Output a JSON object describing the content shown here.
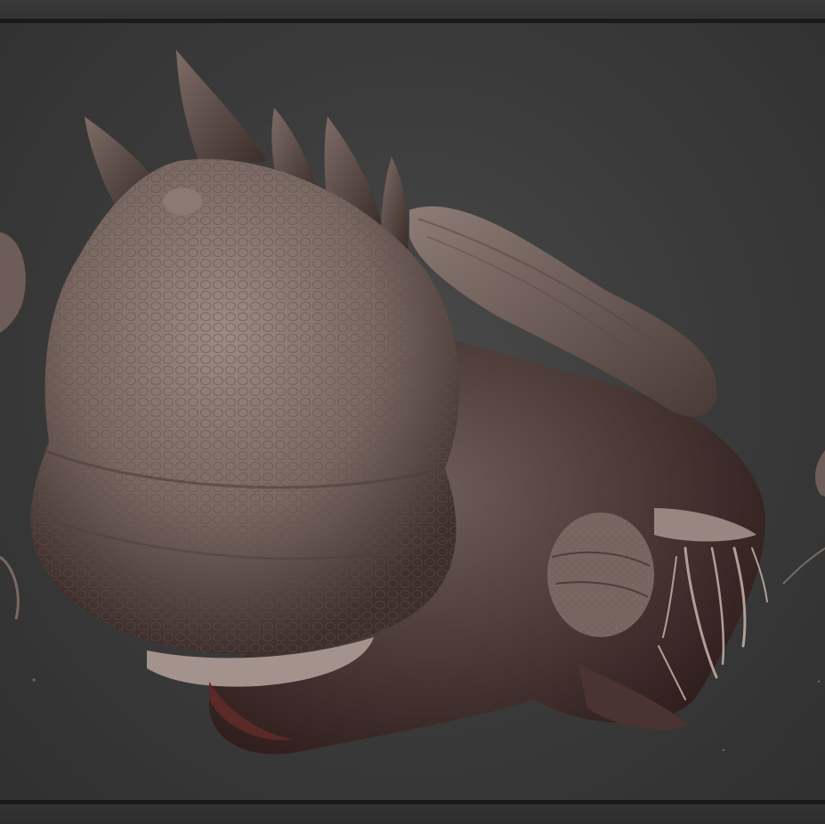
{
  "app": {
    "accent_color": "#1a1a1a",
    "background_color": "#3e3e3e"
  },
  "viewport": {
    "icon": "sculpt-model",
    "model_color": "#8a7770",
    "shadow_color": "#3a1e1e"
  }
}
